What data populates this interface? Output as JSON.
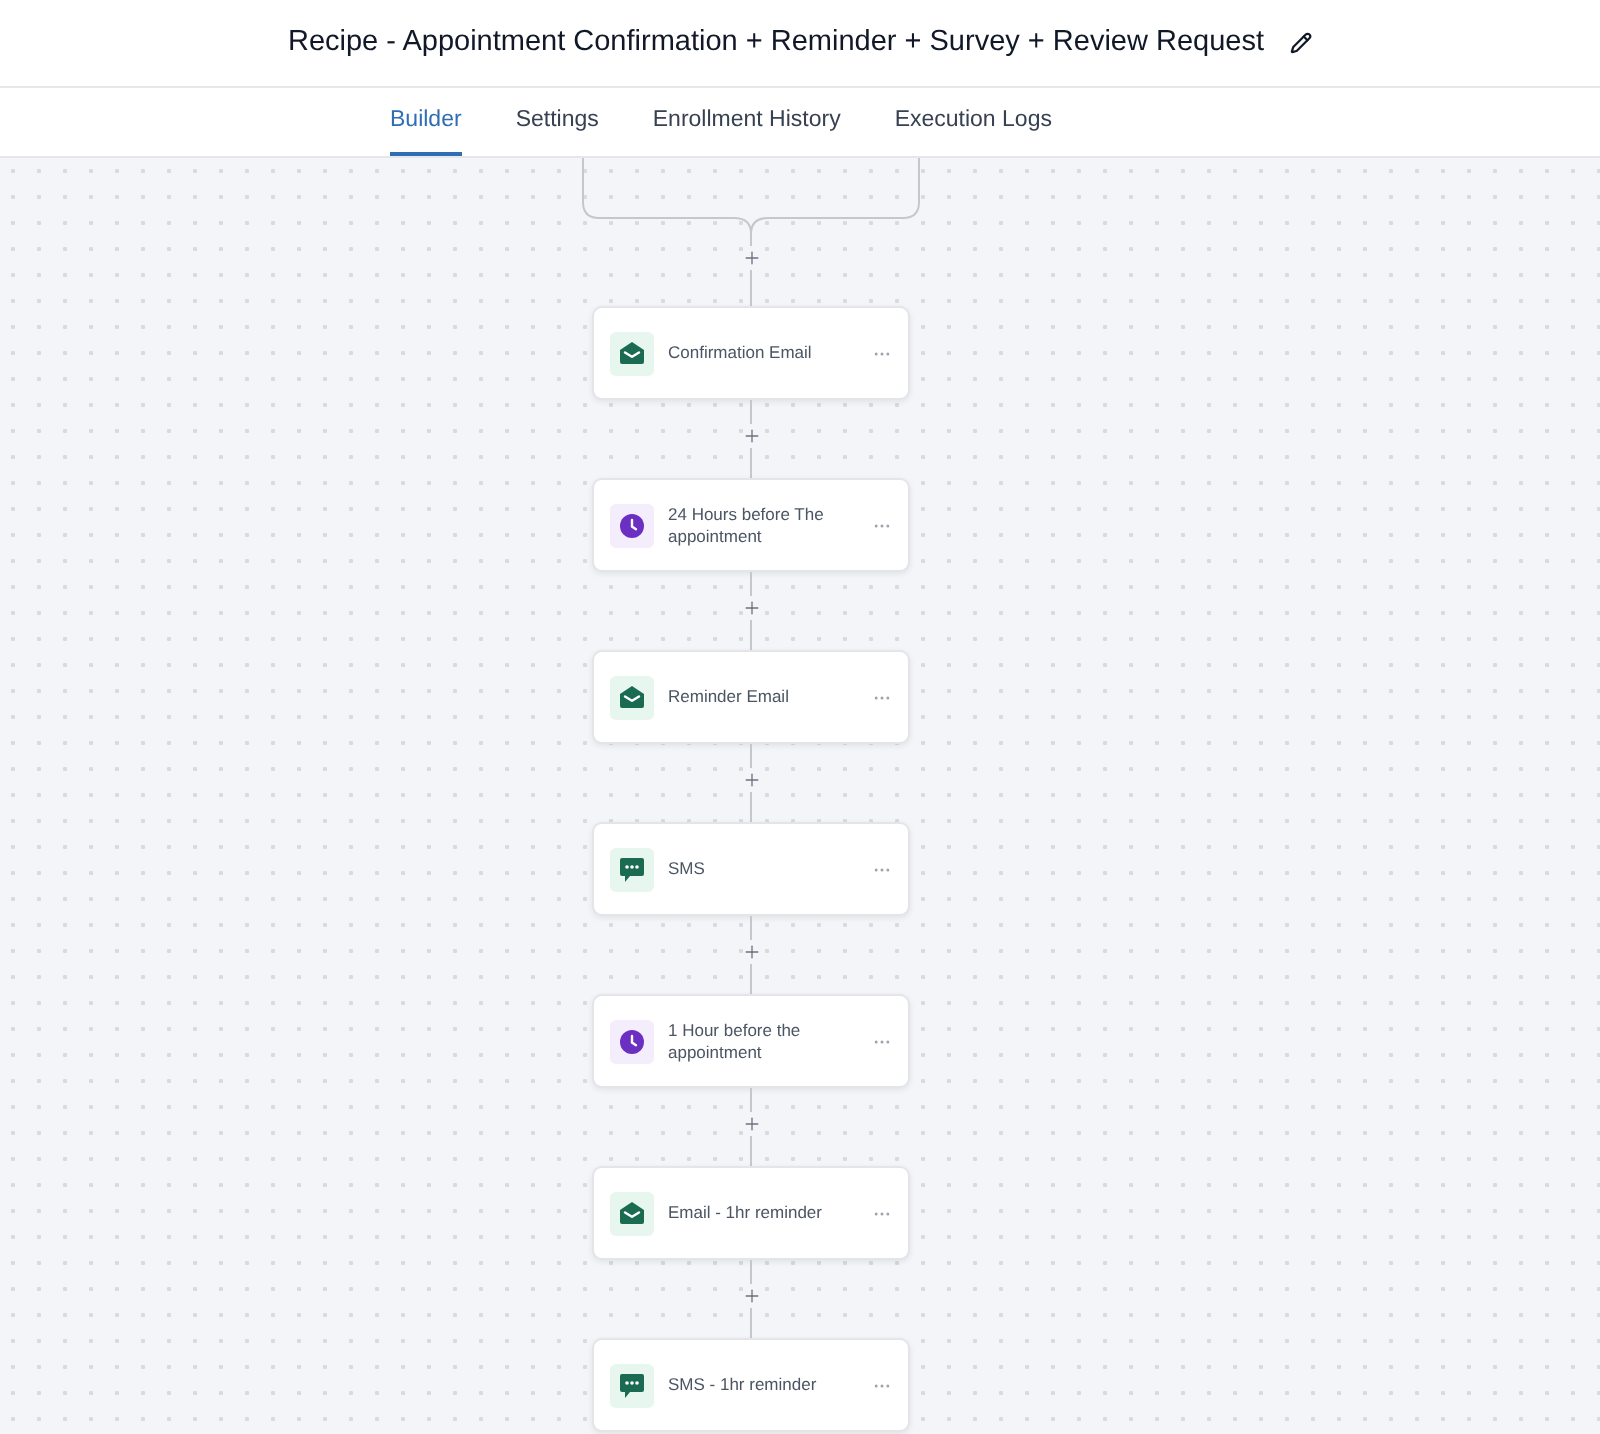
{
  "header": {
    "title": "Recipe - Appointment Confirmation + Reminder + Survey + Review Request"
  },
  "tabs": [
    {
      "label": "Builder",
      "selected": true
    },
    {
      "label": "Settings",
      "selected": false
    },
    {
      "label": "Enrollment History",
      "selected": false
    },
    {
      "label": "Execution Logs",
      "selected": false
    }
  ],
  "steps": [
    {
      "kind": "email",
      "label": "Confirmation Email"
    },
    {
      "kind": "wait",
      "label": "24 Hours before The appointment"
    },
    {
      "kind": "email",
      "label": "Reminder Email"
    },
    {
      "kind": "sms",
      "label": "SMS"
    },
    {
      "kind": "wait",
      "label": "1 Hour before the appointment"
    },
    {
      "kind": "email",
      "label": "Email - 1hr reminder"
    },
    {
      "kind": "sms",
      "label": "SMS - 1hr reminder"
    }
  ]
}
